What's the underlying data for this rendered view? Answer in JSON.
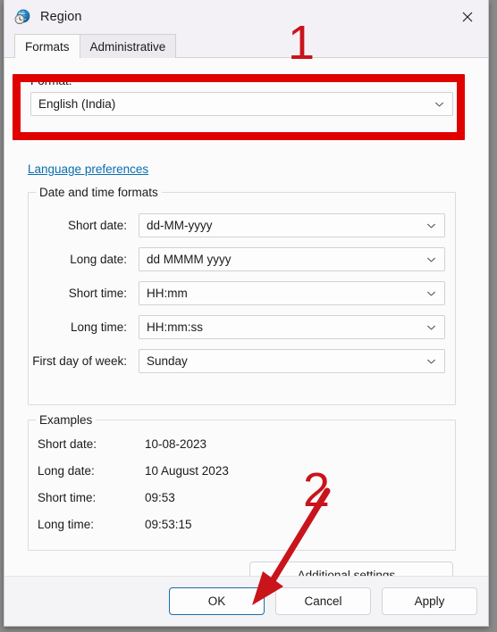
{
  "window": {
    "title": "Region",
    "icon": "region-globe-clock-icon",
    "close_label": "×"
  },
  "tabs": [
    {
      "label": "Formats",
      "active": true
    },
    {
      "label": "Administrative",
      "active": false
    }
  ],
  "format_section": {
    "label": "Format:",
    "value": "English (India)",
    "chevron": "chevron-down-icon"
  },
  "language_link": "Language preferences",
  "date_time_group": {
    "legend": "Date and time formats",
    "rows": [
      {
        "label": "Short date:",
        "value": "dd-MM-yyyy"
      },
      {
        "label": "Long date:",
        "value": "dd MMMM yyyy"
      },
      {
        "label": "Short time:",
        "value": "HH:mm"
      },
      {
        "label": "Long time:",
        "value": "HH:mm:ss"
      },
      {
        "label": "First day of week:",
        "value": "Sunday"
      }
    ]
  },
  "examples_group": {
    "legend": "Examples",
    "rows": [
      {
        "label": "Short date:",
        "value": "10-08-2023"
      },
      {
        "label": "Long date:",
        "value": "10 August 2023"
      },
      {
        "label": "Short time:",
        "value": "09:53"
      },
      {
        "label": "Long time:",
        "value": "09:53:15"
      }
    ]
  },
  "additional_settings_button": "Additional settings...",
  "footer_buttons": {
    "ok": "OK",
    "cancel": "Cancel",
    "apply": "Apply"
  },
  "annotations": {
    "step_one": "1",
    "step_two": "2",
    "highlight_color": "#e00000",
    "number_color": "#c9141b"
  }
}
